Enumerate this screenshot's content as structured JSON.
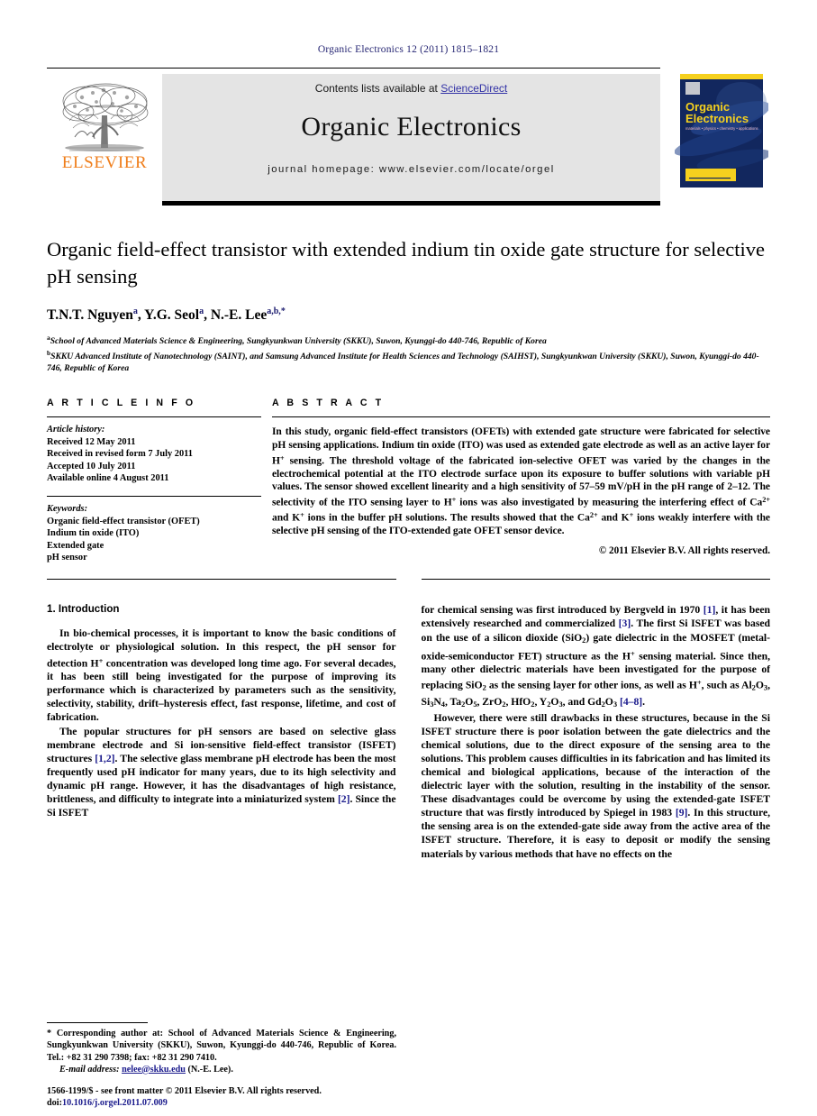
{
  "running_head": "Organic Electronics 12 (2011) 1815–1821",
  "masthead": {
    "contents_prefix": "Contents lists available at ",
    "sciencedirect": "ScienceDirect",
    "journal_title": "Organic Electronics",
    "homepage": "journal homepage: www.elsevier.com/locate/orgel",
    "publisher_logo_text": "ELSEVIER",
    "cover_title_line1": "Organic",
    "cover_title_line2": "Electronics",
    "cover_subtitle": "materials • physics • chemistry • applications",
    "colors": {
      "masthead_bg": "#e4e4e4",
      "link_blue": "#3333a6",
      "elsevier_orange": "#ef7d1a",
      "cover_blue": "#12275e",
      "cover_yellow": "#f5d01e"
    }
  },
  "article": {
    "title": "Organic field-effect transistor with extended indium tin oxide gate structure for selective pH sensing",
    "authors_html": "T.N.T. Nguyen<sup>a</sup>, Y.G. Seol<sup>a</sup>, N.-E. Lee<sup>a,b,</sup><sup>*</sup>",
    "affiliations": [
      {
        "marker": "a",
        "text": "School of Advanced Materials Science & Engineering, Sungkyunkwan University (SKKU), Suwon, Kyunggi-do 440-746, Republic of Korea"
      },
      {
        "marker": "b",
        "text": "SKKU Advanced Institute of Nanotechnology (SAINT), and Samsung Advanced Institute for Health Sciences and Technology (SAIHST), Sungkyunkwan University (SKKU), Suwon, Kyunggi-do 440-746, Republic of Korea"
      }
    ]
  },
  "article_info": {
    "heading": "A R T I C L E   I N F O",
    "history_label": "Article history:",
    "history": [
      "Received 12 May 2011",
      "Received in revised form 7 July 2011",
      "Accepted 10 July 2011",
      "Available online 4 August 2011"
    ],
    "keywords_label": "Keywords:",
    "keywords": [
      "Organic field-effect transistor (OFET)",
      "Indium tin oxide (ITO)",
      "Extended gate",
      "pH sensor"
    ]
  },
  "abstract": {
    "heading": "A B S T R A C T",
    "text_html": "In this study, organic field-effect transistors (OFETs) with extended gate structure were fabricated for selective pH sensing applications. Indium tin oxide (ITO) was used as extended gate electrode as well as an active layer for H<sup class=\"ch\">+</sup> sensing. The threshold voltage of the fabricated ion-selective OFET was varied by the changes in the electrochemical potential at the ITO electrode surface upon its exposure to buffer solutions with variable pH values. The sensor showed excellent linearity and a high sensitivity of 57–59 mV/pH in the pH range of 2–12. The selectivity of the ITO sensing layer to H<sup class=\"ch\">+</sup> ions was also investigated by measuring the interfering effect of Ca<sup class=\"ch\">2+</sup> and K<sup class=\"ch\">+</sup> ions in the buffer pH solutions. The results showed that the Ca<sup class=\"ch\">2+</sup> and K<sup class=\"ch\">+</sup> ions weakly interfere with the selective pH sensing of the ITO-extended gate OFET sensor device.",
    "copyright": "© 2011 Elsevier B.V. All rights reserved."
  },
  "body": {
    "section1_heading": "1. Introduction",
    "left_paragraphs_html": [
      "In bio-chemical processes, it is important to know the basic conditions of electrolyte or physiological solution. In this respect, the pH sensor for detection H<sup class=\"ch\">+</sup> concentration was developed long time ago. For several decades, it has been still being investigated for the purpose of improving its performance which is characterized by parameters such as the sensitivity, selectivity, stability, drift–hysteresis effect, fast response, lifetime, and cost of fabrication.",
      "The popular structures for pH sensors are based on selective glass membrane electrode and Si ion-sensitive field-effect transistor (ISFET) structures <span class=\"ref\">[1,2]</span>. The selective glass membrane pH electrode has been the most frequently used pH indicator for many years, due to its high selectivity and dynamic pH range. However, it has the disadvantages of high resistance, brittleness, and difficulty to integrate into a miniaturized system <span class=\"ref\">[2]</span>. Since the Si ISFET"
    ],
    "right_paragraphs_html": [
      "for chemical sensing was first introduced by Bergveld in 1970 <span class=\"ref\">[1]</span>, it has been extensively researched and commercialized <span class=\"ref\">[3]</span>. The first Si ISFET was based on the use of a silicon dioxide (SiO<sub>2</sub>) gate dielectric in the MOSFET (metal-oxide-semiconductor FET) structure as the H<sup class=\"ch\">+</sup> sensing material. Since then, many other dielectric materials have been investigated for the purpose of replacing SiO<sub>2</sub> as the sensing layer for other ions, as well as H<sup class=\"ch\">+</sup>, such as Al<sub>2</sub>O<sub>3</sub>, Si<sub>3</sub>N<sub>4</sub>, Ta<sub>2</sub>O<sub>5</sub>, ZrO<sub>2</sub>, HfO<sub>2</sub>, Y<sub>2</sub>O<sub>3</sub>, and Gd<sub>2</sub>O<sub>3</sub> <span class=\"ref\">[4–8]</span>.",
      "However, there were still drawbacks in these structures, because in the Si ISFET structure there is poor isolation between the gate dielectrics and the chemical solutions, due to the direct exposure of the sensing area to the solutions. This problem causes difficulties in its fabrication and has limited its chemical and biological applications, because of the interaction of the dielectric layer with the solution, resulting in the instability of the sensor. These disadvantages could be overcome by using the extended-gate ISFET structure that was firstly introduced by Spiegel in 1983 <span class=\"ref\">[9]</span>. In this structure, the sensing area is on the extended-gate side away from the active area of the ISFET structure. Therefore, it is easy to deposit or modify the sensing materials by various methods that have no effects on the"
    ]
  },
  "footnote": {
    "corresponding_html": "* Corresponding author at: School of Advanced Materials Science &amp; Engineering, Sungkyunkwan University (SKKU), Suwon, Kyunggi-do 440-746, Republic of Korea. Tel.: +82 31 290 7398; fax: +82 31 290 7410.",
    "email_label": "E-mail address:",
    "email": "nelee@skku.edu",
    "email_owner": "(N.-E. Lee).",
    "issn_line": "1566-1199/$ - see front matter © 2011 Elsevier B.V. All rights reserved.",
    "doi_label": "doi:",
    "doi": "10.1016/j.orgel.2011.07.009"
  }
}
